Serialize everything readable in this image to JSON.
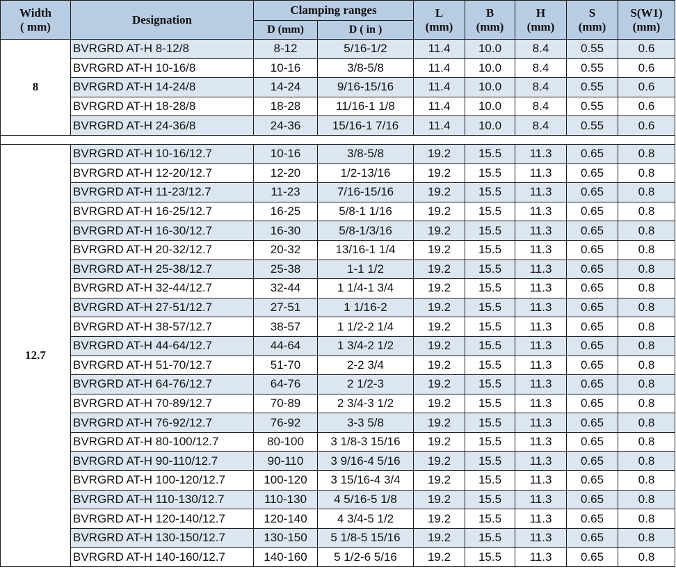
{
  "header": {
    "width_title": "Width",
    "width_unit": "( mm)",
    "designation": "Designation",
    "clamping": "Clamping ranges",
    "d_mm": "D (mm)",
    "d_in": "D ( in )",
    "L": "L",
    "L_unit": "(mm)",
    "B": "B",
    "B_unit": "(mm)",
    "H": "H",
    "H_unit": "(mm)",
    "S": "S",
    "S_unit": "(mm)",
    "SW1": "S(W1)",
    "SW1_unit": "(mm)"
  },
  "groups": [
    {
      "width": "8",
      "rows": [
        {
          "designation": "BVRGRD AT-H 8-12/8",
          "d_mm": "8-12",
          "d_in": "5/16-1/2",
          "L": "11.4",
          "B": "10.0",
          "H": "8.4",
          "S": "0.55",
          "SW1": "0.6"
        },
        {
          "designation": "BVRGRD AT-H 10-16/8",
          "d_mm": "10-16",
          "d_in": "3/8-5/8",
          "L": "11.4",
          "B": "10.0",
          "H": "8.4",
          "S": "0.55",
          "SW1": "0.6"
        },
        {
          "designation": "BVRGRD AT-H 14-24/8",
          "d_mm": "14-24",
          "d_in": "9/16-15/16",
          "L": "11.4",
          "B": "10.0",
          "H": "8.4",
          "S": "0.55",
          "SW1": "0.6"
        },
        {
          "designation": "BVRGRD AT-H 18-28/8",
          "d_mm": "18-28",
          "d_in": "11/16-1 1/8",
          "L": "11.4",
          "B": "10.0",
          "H": "8.4",
          "S": "0.55",
          "SW1": "0.6"
        },
        {
          "designation": "BVRGRD AT-H 24-36/8",
          "d_mm": "24-36",
          "d_in": "15/16-1 7/16",
          "L": "11.4",
          "B": "10.0",
          "H": "8.4",
          "S": "0.55",
          "SW1": "0.6"
        }
      ]
    },
    {
      "width": "12.7",
      "rows": [
        {
          "designation": "BVRGRD AT-H 10-16/12.7",
          "d_mm": "10-16",
          "d_in": "3/8-5/8",
          "L": "19.2",
          "B": "15.5",
          "H": "11.3",
          "S": "0.65",
          "SW1": "0.8"
        },
        {
          "designation": "BVRGRD AT-H 12-20/12.7",
          "d_mm": "12-20",
          "d_in": "1/2-13/16",
          "L": "19.2",
          "B": "15.5",
          "H": "11.3",
          "S": "0.65",
          "SW1": "0.8"
        },
        {
          "designation": "BVRGRD AT-H 11-23/12.7",
          "d_mm": "11-23",
          "d_in": "7/16-15/16",
          "L": "19.2",
          "B": "15.5",
          "H": "11.3",
          "S": "0.65",
          "SW1": "0.8"
        },
        {
          "designation": "BVRGRD AT-H 16-25/12.7",
          "d_mm": "16-25",
          "d_in": "5/8-1 1/16",
          "L": "19.2",
          "B": "15.5",
          "H": "11.3",
          "S": "0.65",
          "SW1": "0.8"
        },
        {
          "designation": "BVRGRD AT-H 16-30/12.7",
          "d_mm": "16-30",
          "d_in": "5/8-1/3/16",
          "L": "19.2",
          "B": "15.5",
          "H": "11.3",
          "S": "0.65",
          "SW1": "0.8"
        },
        {
          "designation": "BVRGRD AT-H 20-32/12.7",
          "d_mm": "20-32",
          "d_in": "13/16-1 1/4",
          "L": "19.2",
          "B": "15.5",
          "H": "11.3",
          "S": "0.65",
          "SW1": "0.8"
        },
        {
          "designation": "BVRGRD AT-H 25-38/12.7",
          "d_mm": "25-38",
          "d_in": "1-1 1/2",
          "L": "19.2",
          "B": "15.5",
          "H": "11.3",
          "S": "0.65",
          "SW1": "0.8"
        },
        {
          "designation": "BVRGRD AT-H 32-44/12.7",
          "d_mm": "32-44",
          "d_in": "1 1/4-1 3/4",
          "L": "19.2",
          "B": "15.5",
          "H": "11.3",
          "S": "0.65",
          "SW1": "0.8"
        },
        {
          "designation": "BVRGRD AT-H 27-51/12.7",
          "d_mm": "27-51",
          "d_in": "1 1/16-2",
          "L": "19.2",
          "B": "15.5",
          "H": "11.3",
          "S": "0.65",
          "SW1": "0.8"
        },
        {
          "designation": "BVRGRD AT-H 38-57/12.7",
          "d_mm": "38-57",
          "d_in": "1 1/2-2 1/4",
          "L": "19.2",
          "B": "15.5",
          "H": "11.3",
          "S": "0.65",
          "SW1": "0.8"
        },
        {
          "designation": "BVRGRD AT-H 44-64/12.7",
          "d_mm": "44-64",
          "d_in": "1 3/4-2 1/2",
          "L": "19.2",
          "B": "15.5",
          "H": "11.3",
          "S": "0.65",
          "SW1": "0.8"
        },
        {
          "designation": "BVRGRD AT-H 51-70/12.7",
          "d_mm": "51-70",
          "d_in": "2-2 3/4",
          "L": "19.2",
          "B": "15.5",
          "H": "11.3",
          "S": "0.65",
          "SW1": "0.8"
        },
        {
          "designation": "BVRGRD AT-H 64-76/12.7",
          "d_mm": "64-76",
          "d_in": "2 1/2-3",
          "L": "19.2",
          "B": "15.5",
          "H": "11.3",
          "S": "0.65",
          "SW1": "0.8"
        },
        {
          "designation": "BVRGRD AT-H 70-89/12.7",
          "d_mm": "70-89",
          "d_in": "2 3/4-3 1/2",
          "L": "19.2",
          "B": "15.5",
          "H": "11.3",
          "S": "0.65",
          "SW1": "0.8"
        },
        {
          "designation": "BVRGRD AT-H 76-92/12.7",
          "d_mm": "76-92",
          "d_in": "3-3 5/8",
          "L": "19.2",
          "B": "15.5",
          "H": "11.3",
          "S": "0.65",
          "SW1": "0.8"
        },
        {
          "designation": "BVRGRD AT-H 80-100/12.7",
          "d_mm": "80-100",
          "d_in": "3 1/8-3 15/16",
          "L": "19.2",
          "B": "15.5",
          "H": "11.3",
          "S": "0.65",
          "SW1": "0.8"
        },
        {
          "designation": "BVRGRD AT-H 90-110/12.7",
          "d_mm": "90-110",
          "d_in": "3 9/16-4 5/16",
          "L": "19.2",
          "B": "15.5",
          "H": "11.3",
          "S": "0.65",
          "SW1": "0.8"
        },
        {
          "designation": "BVRGRD AT-H 100-120/12.7",
          "d_mm": "100-120",
          "d_in": "3 15/16-4 3/4",
          "L": "19.2",
          "B": "15.5",
          "H": "11.3",
          "S": "0.65",
          "SW1": "0.8"
        },
        {
          "designation": "BVRGRD AT-H 110-130/12.7",
          "d_mm": "110-130",
          "d_in": "4 5/16-5 1/8",
          "L": "19.2",
          "B": "15.5",
          "H": "11.3",
          "S": "0.65",
          "SW1": "0.8"
        },
        {
          "designation": "BVRGRD AT-H 120-140/12.7",
          "d_mm": "120-140",
          "d_in": "4 3/4-5 1/2",
          "L": "19.2",
          "B": "15.5",
          "H": "11.3",
          "S": "0.65",
          "SW1": "0.8"
        },
        {
          "designation": "BVRGRD AT-H 130-150/12.7",
          "d_mm": "130-150",
          "d_in": "5 1/8-5 15/16",
          "L": "19.2",
          "B": "15.5",
          "H": "11.3",
          "S": "0.65",
          "SW1": "0.8"
        },
        {
          "designation": "BVRGRD AT-H 140-160/12.7",
          "d_mm": "140-160",
          "d_in": "5 1/2-6 5/16",
          "L": "19.2",
          "B": "15.5",
          "H": "11.3",
          "S": "0.65",
          "SW1": "0.8"
        }
      ]
    }
  ],
  "colors": {
    "header_bg": "#b8cce4",
    "row_shade": "#dce6f1",
    "row_plain": "#ffffff",
    "border": "#1a1a1a"
  }
}
